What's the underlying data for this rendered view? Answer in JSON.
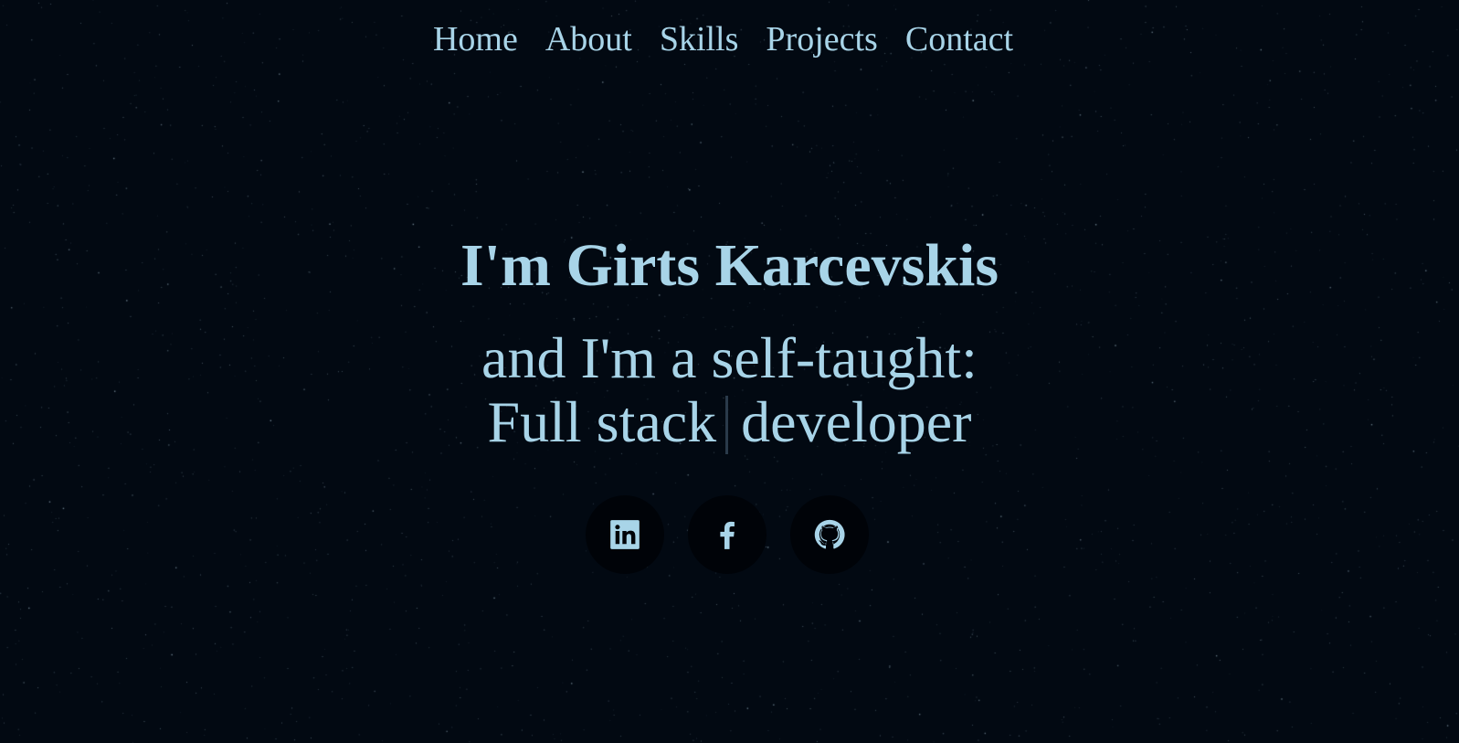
{
  "nav": {
    "items": [
      {
        "label": "Home"
      },
      {
        "label": "About"
      },
      {
        "label": "Skills"
      },
      {
        "label": "Projects"
      },
      {
        "label": "Contact"
      }
    ]
  },
  "hero": {
    "name": "I'm Girts Karcevskis",
    "subtitle": "and I'm a self-taught:",
    "role_prefix": "Full stack",
    "role_suffix": "developer"
  },
  "socials": [
    {
      "icon": "linkedin-icon"
    },
    {
      "icon": "facebook-icon"
    },
    {
      "icon": "github-icon"
    }
  ],
  "colors": {
    "background": "#020912",
    "text": "#a8d4e8",
    "social_bg": "#000308",
    "star": "#9fb8c8"
  }
}
